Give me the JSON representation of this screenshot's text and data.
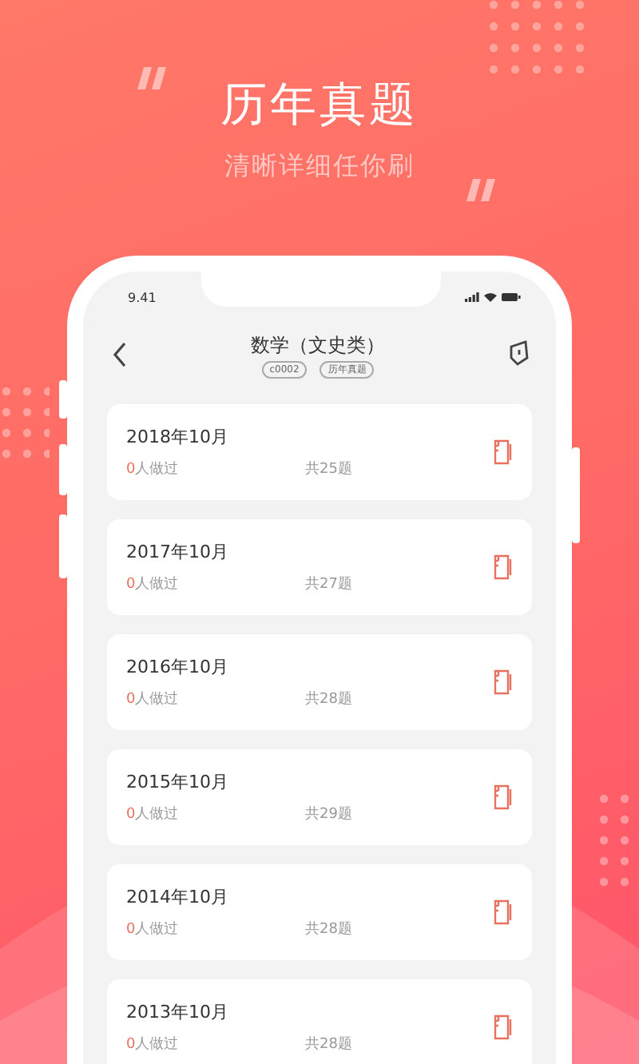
{
  "hero": {
    "title": "历年真题",
    "subtitle": "清晰详细任你刷"
  },
  "status_bar": {
    "time": "9.41"
  },
  "nav": {
    "title": "数学（文史类）",
    "tags": [
      "c0002",
      "历年真题"
    ]
  },
  "papers": [
    {
      "date": "2018年10月",
      "done_count": "0",
      "done_label": "人做过",
      "total": "共25题"
    },
    {
      "date": "2017年10月",
      "done_count": "0",
      "done_label": "人做过",
      "total": "共27题"
    },
    {
      "date": "2016年10月",
      "done_count": "0",
      "done_label": "人做过",
      "total": "共28题"
    },
    {
      "date": "2015年10月",
      "done_count": "0",
      "done_label": "人做过",
      "total": "共29题"
    },
    {
      "date": "2014年10月",
      "done_count": "0",
      "done_label": "人做过",
      "total": "共28题"
    },
    {
      "date": "2013年10月",
      "done_count": "0",
      "done_label": "人做过",
      "total": "共28题"
    }
  ]
}
